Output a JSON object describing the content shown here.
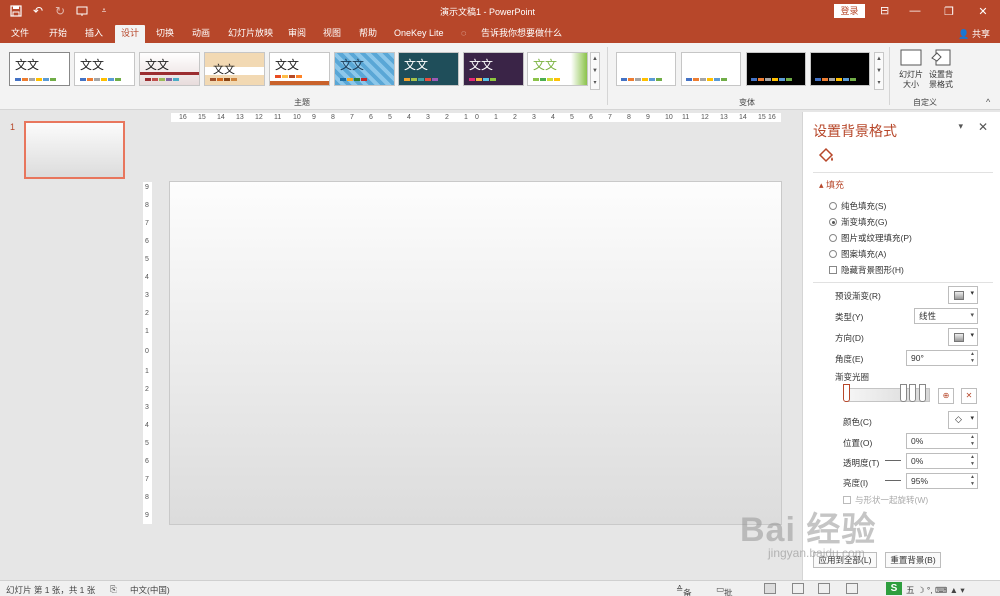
{
  "titlebar": {
    "title": "演示文稿1 - PowerPoint",
    "login": "登录"
  },
  "tabs": [
    "文件",
    "开始",
    "插入",
    "设计",
    "切换",
    "动画",
    "幻灯片放映",
    "审阅",
    "视图",
    "帮助",
    "OneKey Lite"
  ],
  "active_tab": "设计",
  "tellme": "告诉我你想要做什么",
  "share": "共享",
  "ribbon": {
    "theme_thumb_text": "文文",
    "theme_group": "主题",
    "variant_group": "变体",
    "slide_size": "幻灯片大小",
    "format_bg": "设置背景格式",
    "custom_group": "自定义"
  },
  "slides": {
    "number": "1"
  },
  "hruler": [
    "16",
    "15",
    "14",
    "13",
    "12",
    "11",
    "10",
    "9",
    "8",
    "7",
    "6",
    "5",
    "4",
    "3",
    "2",
    "1",
    "0",
    "1",
    "2",
    "3",
    "4",
    "5",
    "6",
    "7",
    "8",
    "9",
    "10",
    "11",
    "12",
    "13",
    "14",
    "15",
    "16"
  ],
  "vruler": [
    "9",
    "8",
    "7",
    "6",
    "5",
    "4",
    "3",
    "2",
    "1",
    "0",
    "1",
    "2",
    "3",
    "4",
    "5",
    "6",
    "7",
    "8",
    "9"
  ],
  "pane": {
    "title": "设置背景格式",
    "fill_section": "填充",
    "options": [
      "纯色填充(S)",
      "渐变填充(G)",
      "图片或纹理填充(P)",
      "图案填充(A)"
    ],
    "selected_option": 1,
    "hide_bg": "隐藏背景图形(H)",
    "preset": "预设渐变(R)",
    "type_label": "类型(Y)",
    "type_value": "线性",
    "direction": "方向(D)",
    "angle_label": "角度(E)",
    "angle_value": "90°",
    "stops_label": "渐变光圈",
    "color_label": "颜色(C)",
    "position_label": "位置(O)",
    "position_value": "0%",
    "transparency_label": "透明度(T)",
    "transparency_value": "0%",
    "brightness_label": "亮度(I)",
    "brightness_value": "95%",
    "rotate_label": "与形状一起旋转(W)",
    "apply_all": "应用到全部(L)",
    "reset": "重置背景(B)"
  },
  "status": {
    "slide_info": "幻灯片 第 1 张，共 1 张",
    "language": "中文(中国)",
    "notes": "备注",
    "comments": "批注"
  },
  "watermark": {
    "main": "Bai 经验",
    "sub": "jingyan.baidu.com"
  },
  "colors": {
    "accent": "#b7472a",
    "ribbon": "#f3f3f3"
  }
}
